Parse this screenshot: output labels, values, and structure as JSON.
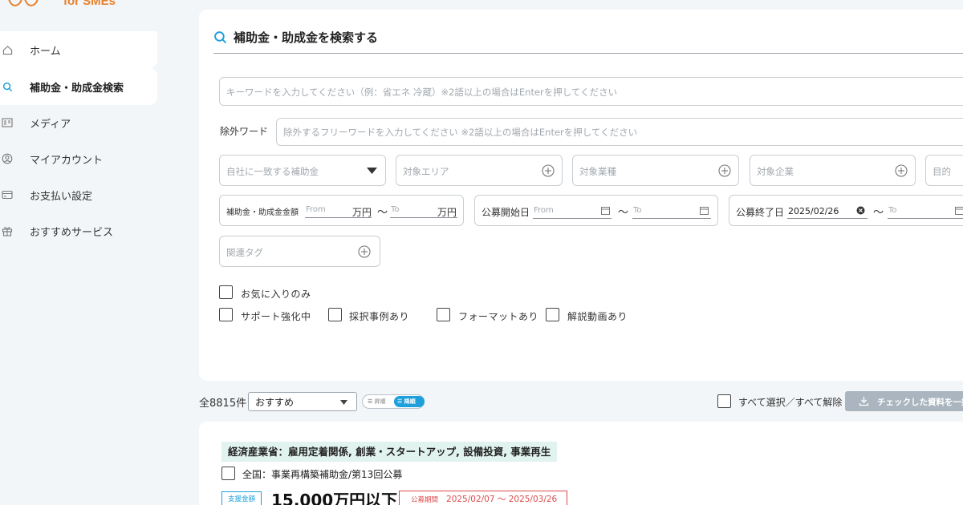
{
  "brand": {
    "logo_text": "for SMEs",
    "accent": "#e8802c"
  },
  "sidebar": {
    "items": [
      {
        "label": "ホーム",
        "icon": "home-icon"
      },
      {
        "label": "補助金・助成金検索",
        "icon": "search-icon",
        "active": true
      },
      {
        "label": "メディア",
        "icon": "media-icon"
      },
      {
        "label": "マイアカウント",
        "icon": "user-icon"
      },
      {
        "label": "お支払い設定",
        "icon": "card-icon"
      },
      {
        "label": "おすすめサービス",
        "icon": "gift-icon"
      }
    ]
  },
  "search": {
    "title": "補助金・助成金を検索する",
    "keyword_placeholder": "キーワードを入力してください（例：省エネ 冷蔵）※2語以上の場合はEnterを押してください",
    "exclude_label": "除外ワード",
    "exclude_placeholder": "除外するフリーワードを入力してください ※2語以上の場合はEnterを押してください",
    "match_select": "自社に一致する補助金",
    "area": "対象エリア",
    "industry": "対象業種",
    "company": "対象企業",
    "purpose": "目的",
    "amount_label": "補助金・助成金金額",
    "from": "From",
    "to": "To",
    "unit": "万円",
    "tilde": "〜",
    "start_label": "公募開始日",
    "end_label": "公募終了日",
    "end_from_value": "2025/02/26",
    "related_tag": "関連タグ",
    "favorites_only": "お気に入りのみ",
    "checks": [
      "サポート強化中",
      "採択事例あり",
      "フォーマットあり",
      "解説動画あり"
    ]
  },
  "results": {
    "count": "全8815件",
    "sort_value": "おすすめ",
    "order_asc": "昇順",
    "order_desc": "降順",
    "select_all": "すべて選択／すべて解除",
    "download_button": "チェックした資料を一括",
    "item": {
      "category": "経済産業省：雇用定着関係, 創業・スタートアップ, 設備投資, 事業再生",
      "title": "全国：事業再構築補助金/第13回公募",
      "amount_badge": "支援金額",
      "amount": "15,000万円以下",
      "period_label": "公募期間",
      "period": "2025/02/07 〜 2025/03/26"
    }
  },
  "colors": {
    "primary": "#1ea0dc",
    "danger": "#e04a4a",
    "tag_bg": "#e1f3ef"
  }
}
